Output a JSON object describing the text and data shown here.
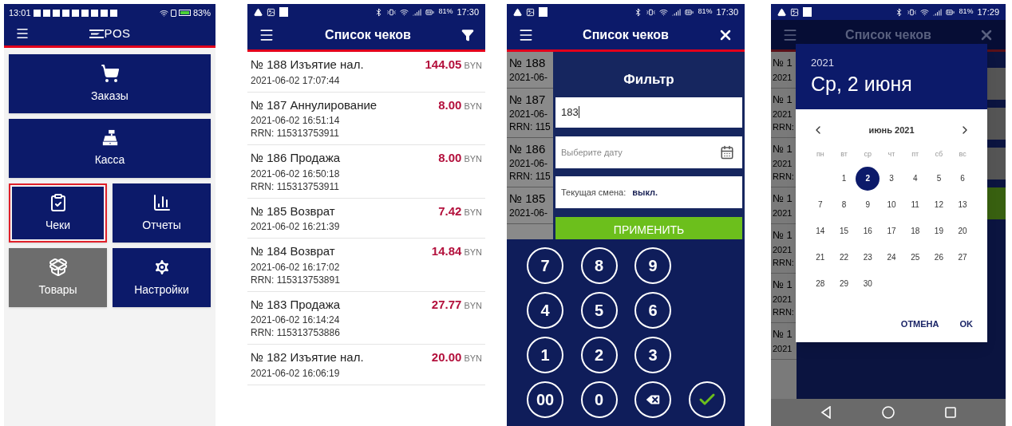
{
  "main_menu": {
    "status_bar": {
      "time": "13:01",
      "battery": "83%"
    },
    "logo": "POS",
    "tiles": [
      {
        "label": "Заказы",
        "kind": "orders",
        "wide": true,
        "highlighted": false,
        "disabled": false
      },
      {
        "label": "Касса",
        "kind": "cash",
        "wide": true,
        "highlighted": false,
        "disabled": false
      },
      {
        "label": "Чеки",
        "kind": "receipts",
        "wide": false,
        "highlighted": true,
        "disabled": false
      },
      {
        "label": "Отчеты",
        "kind": "reports",
        "wide": false,
        "highlighted": false,
        "disabled": false
      },
      {
        "label": "Товары",
        "kind": "goods",
        "wide": false,
        "highlighted": false,
        "disabled": true
      },
      {
        "label": "Настройки",
        "kind": "settings",
        "wide": false,
        "highlighted": false,
        "disabled": false
      }
    ]
  },
  "receipt_list": {
    "status_bar": {
      "time": "17:30",
      "battery": "81%"
    },
    "title": "Список чеков",
    "receipts": [
      {
        "title": "№ 188 Изъятие нал.",
        "amount": "144.05",
        "currency": "BYN",
        "lines": [
          "2021-06-02 17:07:44"
        ]
      },
      {
        "title": "№ 187 Аннулирование",
        "amount": "8.00",
        "currency": "BYN",
        "lines": [
          "2021-06-02 16:51:14",
          "RRN: 115313753911"
        ]
      },
      {
        "title": "№ 186 Продажа",
        "amount": "8.00",
        "currency": "BYN",
        "lines": [
          "2021-06-02 16:50:18",
          "RRN: 115313753911"
        ]
      },
      {
        "title": "№ 185 Возврат",
        "amount": "7.42",
        "currency": "BYN",
        "lines": [
          "2021-06-02 16:21:39"
        ]
      },
      {
        "title": "№ 184 Возврат",
        "amount": "14.84",
        "currency": "BYN",
        "lines": [
          "2021-06-02 16:17:02",
          "RRN: 115313753891"
        ]
      },
      {
        "title": "№ 183 Продажа",
        "amount": "27.77",
        "currency": "BYN",
        "lines": [
          "2021-06-02 16:14:24",
          "RRN: 115313753886"
        ]
      },
      {
        "title": "№ 182 Изъятие нал.",
        "amount": "20.00",
        "currency": "BYN",
        "lines": [
          "2021-06-02 16:06:19"
        ]
      }
    ]
  },
  "filter_screen": {
    "status_bar": {
      "time": "17:30",
      "battery": "81%"
    },
    "title": "Список чеков",
    "background_rows": [
      {
        "title": "№ 188",
        "lines": [
          "2021-06-"
        ]
      },
      {
        "title": "№ 187",
        "lines": [
          "2021-06-",
          "RRN: 115"
        ]
      },
      {
        "title": "№ 186",
        "lines": [
          "2021-06-",
          "RRN: 115"
        ]
      },
      {
        "title": "№ 185",
        "lines": [
          "2021-06-"
        ]
      }
    ],
    "filter": {
      "title": "Фильтр",
      "number_field": {
        "value": "183"
      },
      "date_field": {
        "placeholder": "Выберите дату"
      },
      "shift": {
        "label": "Текущая смена:",
        "value": "выкл."
      },
      "apply_button": "ПРИМЕНИТЬ"
    },
    "keypad": [
      {
        "kind": "digit",
        "label": "7"
      },
      {
        "kind": "digit",
        "label": "8"
      },
      {
        "kind": "digit",
        "label": "9"
      },
      {
        "kind": "space"
      },
      {
        "kind": "digit",
        "label": "4"
      },
      {
        "kind": "digit",
        "label": "5"
      },
      {
        "kind": "digit",
        "label": "6"
      },
      {
        "kind": "space"
      },
      {
        "kind": "digit",
        "label": "1"
      },
      {
        "kind": "digit",
        "label": "2"
      },
      {
        "kind": "digit",
        "label": "3"
      },
      {
        "kind": "space"
      },
      {
        "kind": "digit",
        "label": "00"
      },
      {
        "kind": "digit",
        "label": "0"
      },
      {
        "kind": "backspace"
      },
      {
        "kind": "confirm"
      }
    ]
  },
  "date_picker_screen": {
    "status_bar": {
      "time": "17:29",
      "battery": "81%"
    },
    "title": "Список чеков",
    "background_rows": [
      {
        "title": "№ 1",
        "lines": [
          "2021"
        ]
      },
      {
        "title": "№ 1",
        "lines": [
          "2021",
          "RRN:"
        ]
      },
      {
        "title": "№ 1",
        "lines": [
          "2021",
          "RRN:"
        ]
      },
      {
        "title": "№ 1",
        "lines": [
          "2021"
        ]
      },
      {
        "title": "№ 1",
        "lines": [
          "2021",
          "RRN:"
        ]
      },
      {
        "title": "№ 1",
        "lines": [
          "2021",
          "RRN:"
        ]
      },
      {
        "title": "№ 1",
        "lines": [
          "2021"
        ]
      }
    ],
    "dialog": {
      "year": "2021",
      "date": "Ср, 2 июня",
      "month": "июнь 2021",
      "weekdays": [
        "пн",
        "вт",
        "ср",
        "чт",
        "пт",
        "сб",
        "вс"
      ],
      "weeks": [
        [
          {
            "day": "1",
            "selected": false
          },
          {
            "day": "2",
            "selected": true
          },
          {
            "day": "3",
            "selected": false
          },
          {
            "day": "4",
            "selected": false
          },
          {
            "day": "5",
            "selected": false
          },
          {
            "day": "6",
            "selected": false
          }
        ],
        [
          {
            "day": "7",
            "selected": false
          },
          {
            "day": "8",
            "selected": false
          },
          {
            "day": "9",
            "selected": false
          },
          {
            "day": "10",
            "selected": false
          },
          {
            "day": "11",
            "selected": false
          },
          {
            "day": "12",
            "selected": false
          },
          {
            "day": "13",
            "selected": false
          }
        ],
        [
          {
            "day": "14",
            "selected": false
          },
          {
            "day": "15",
            "selected": false
          },
          {
            "day": "16",
            "selected": false
          },
          {
            "day": "17",
            "selected": false
          },
          {
            "day": "18",
            "selected": false
          },
          {
            "day": "19",
            "selected": false
          },
          {
            "day": "20",
            "selected": false
          }
        ],
        [
          {
            "day": "21",
            "selected": false
          },
          {
            "day": "22",
            "selected": false
          },
          {
            "day": "23",
            "selected": false
          },
          {
            "day": "24",
            "selected": false
          },
          {
            "day": "25",
            "selected": false
          },
          {
            "day": "26",
            "selected": false
          },
          {
            "day": "27",
            "selected": false
          }
        ],
        [
          {
            "day": "28",
            "selected": false
          },
          {
            "day": "29",
            "selected": false
          },
          {
            "day": "30",
            "selected": false
          }
        ]
      ],
      "cancel_button": "ОТМЕНА",
      "ok_button": "OK"
    }
  }
}
